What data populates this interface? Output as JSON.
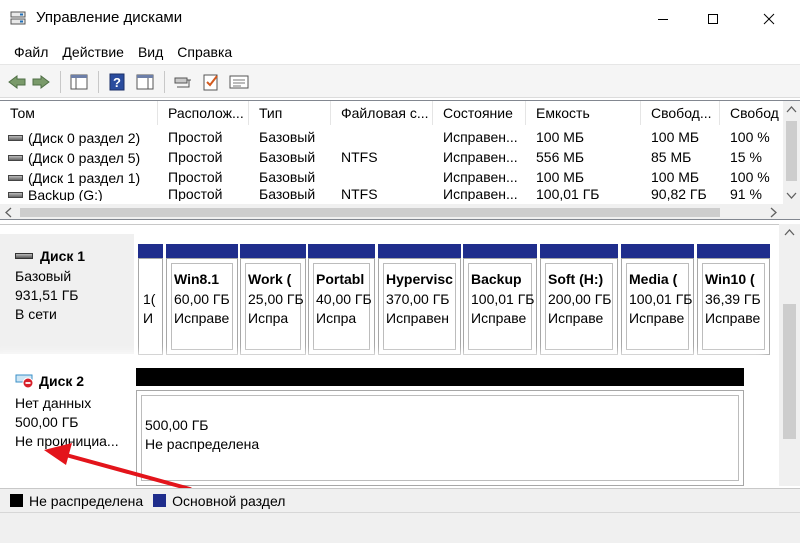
{
  "window": {
    "title": "Управление дисками",
    "minimize_glyph": "—",
    "maximize_glyph": "☐",
    "close_glyph": "✕"
  },
  "menu": [
    "Файл",
    "Действие",
    "Вид",
    "Справка"
  ],
  "toolbar": {
    "icons": [
      "back-arrow-icon",
      "forward-arrow-icon",
      "console-tree-icon",
      "help-icon",
      "action-pane-icon",
      "connect-icon",
      "checklist-icon",
      "properties-icon"
    ]
  },
  "volumes": {
    "columns": [
      "Том",
      "Располож...",
      "Тип",
      "Файловая с...",
      "Состояние",
      "Емкость",
      "Свобод...",
      "Свобод"
    ],
    "rows": [
      [
        "(Диск 0 раздел 2)",
        "Простой",
        "Базовый",
        "",
        "Исправен...",
        "100 МБ",
        "100 МБ",
        "100 %"
      ],
      [
        "(Диск 0 раздел 5)",
        "Простой",
        "Базовый",
        "NTFS",
        "Исправен...",
        "556 МБ",
        "85 МБ",
        "15 %"
      ],
      [
        "(Диск 1 раздел 1)",
        "Простой",
        "Базовый",
        "",
        "Исправен...",
        "100 МБ",
        "100 МБ",
        "100 %"
      ],
      [
        "Backup (G:)",
        "Простой",
        "Базовый",
        "NTFS",
        "Исправен...",
        "100,01 ГБ",
        "90,82 ГБ",
        "91 %"
      ]
    ]
  },
  "disk1": {
    "name": "Диск 1",
    "type": "Базовый",
    "size": "931,51 ГБ",
    "status": "В сети",
    "stub_size": "1(",
    "stub_state": "И",
    "partitions": [
      {
        "name": "Win8.1",
        "size": "60,00 ГБ",
        "state": "Исправе"
      },
      {
        "name": "Work  (",
        "size": "25,00 ГБ",
        "state": "Испра"
      },
      {
        "name": "Portabl",
        "size": "40,00 ГБ",
        "state": "Испра"
      },
      {
        "name": "Hypervisc",
        "size": "370,00 ГБ",
        "state": "Исправен"
      },
      {
        "name": "Backup",
        "size": "100,01 ГБ",
        "state": "Исправе"
      },
      {
        "name": "Soft  (H:)",
        "size": "200,00 ГБ",
        "state": "Исправе"
      },
      {
        "name": "Media  (",
        "size": "100,01 ГБ",
        "state": "Исправе"
      },
      {
        "name": "Win10  (",
        "size": "36,39 ГБ",
        "state": "Исправе"
      }
    ]
  },
  "disk2": {
    "name": "Диск 2",
    "type": "Нет данных",
    "size": "500,00 ГБ",
    "status": "Не проинициа...",
    "unallocated_size": "500,00 ГБ",
    "unallocated_label": "Не распределена"
  },
  "legend": [
    {
      "label": "Не распределена",
      "color": "#000000"
    },
    {
      "label": "Основной раздел",
      "color": "#1f2d8c"
    }
  ],
  "colors": {
    "primary_partition": "#1f2d8c",
    "unallocated": "#000000",
    "annotation_arrow": "#e3141b"
  }
}
